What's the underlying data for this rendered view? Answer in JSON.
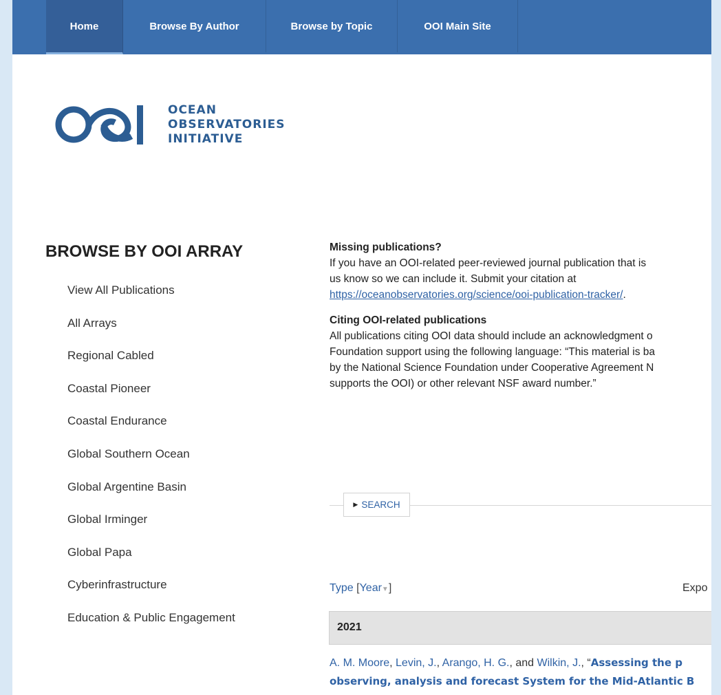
{
  "nav": {
    "items": [
      {
        "label": "Home",
        "active": true
      },
      {
        "label": "Browse By Author"
      },
      {
        "label": "Browse by Topic"
      },
      {
        "label": "OOI Main Site"
      }
    ]
  },
  "logo": {
    "mark": "OOI",
    "line1": "OCEAN",
    "line2": "OBSERVATORIES",
    "line3": "INITIATIVE",
    "color": "#2c5d93"
  },
  "sidebar": {
    "title": "BROWSE BY OOI ARRAY",
    "items": [
      "View All Publications",
      "All Arrays",
      "Regional Cabled",
      "Coastal Pioneer",
      "Coastal Endurance",
      "Global Southern Ocean",
      "Global Argentine Basin",
      "Global Irminger",
      "Global Papa",
      "Cyberinfrastructure",
      "Education & Public Engagement"
    ]
  },
  "content": {
    "missing": {
      "heading": "Missing publications?",
      "line1": "If you have an OOI-related peer-reviewed journal publication that is",
      "line2": "us know so we can include it. Submit your citation at",
      "link": "https://oceanobservatories.org/science/ooi-publication-tracker/",
      "link_suffix": "."
    },
    "citing": {
      "heading": "Citing OOI-related publications",
      "line1": "All publications citing OOI data should include an acknowledgment o",
      "line2": "Foundation support using the following language: “This material is ba",
      "line3": "by the National Science Foundation under Cooperative Agreement N",
      "line4": "supports the OOI) or other relevant NSF award number.”"
    }
  },
  "search": {
    "label": "SEARCH"
  },
  "sort": {
    "type_label": "Type",
    "open_bracket": "[",
    "year_label": "Year",
    "close_bracket": "]",
    "export_label": "Expo"
  },
  "year_band": {
    "year": "2021"
  },
  "citation": {
    "author1": "A. M. Moore",
    "author2": "Levin, J.",
    "author3": "Arango, H. G.",
    "and": "and",
    "author4": "Wilkin, J.",
    "title_line1": "Assessing the p",
    "title_line2": "observing, analysis and forecast System for the Mid-Atlantic B"
  },
  "colors": {
    "nav_bg": "#3b6fae",
    "page_bg": "#d9e8f5",
    "link": "#2f62a5",
    "year_band_bg": "#e3e3e3"
  }
}
